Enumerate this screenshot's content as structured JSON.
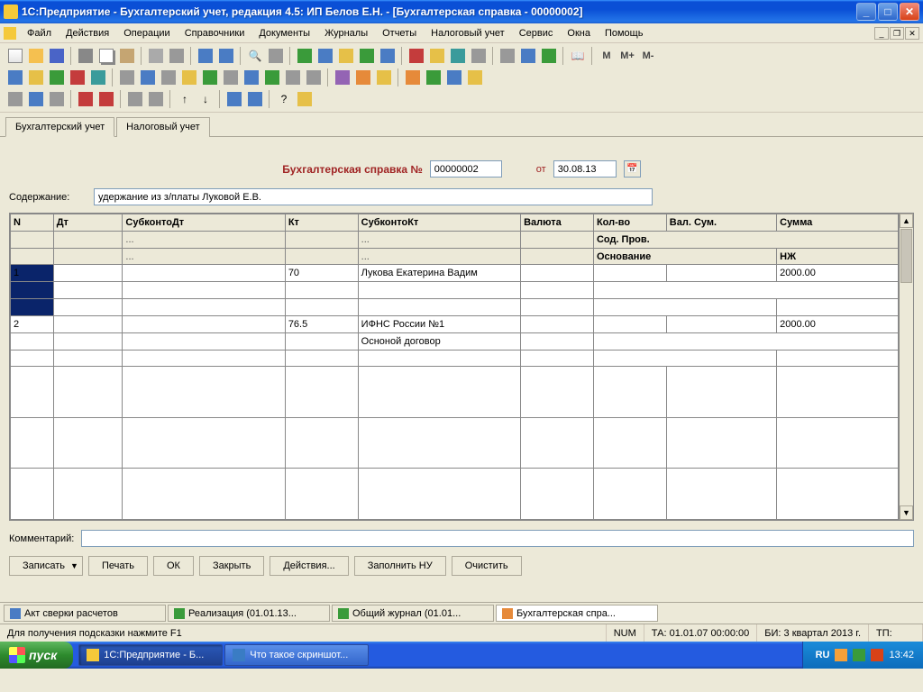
{
  "window": {
    "title": "1С:Предприятие - Бухгалтерский учет, редакция 4.5: ИП Белов Е.Н. - [Бухгалтерская справка - 00000002]"
  },
  "menu": {
    "file": "Файл",
    "actions": "Действия",
    "operations": "Операции",
    "refs": "Справочники",
    "docs": "Документы",
    "journals": "Журналы",
    "reports": "Отчеты",
    "tax": "Налоговый учет",
    "service": "Сервис",
    "windows": "Окна",
    "help": "Помощь"
  },
  "toolbar_text": {
    "m": "М",
    "mplus": "М+",
    "mminus": "М-"
  },
  "tabs": {
    "tab1": "Бухгалтерский учет",
    "tab2": "Налоговый учет"
  },
  "doc": {
    "heading": "Бухгалтерская справка №",
    "number": "00000002",
    "from_label": "от",
    "date": "30.08.13",
    "content_label": "Содержание:",
    "content_value": "удержание из з/платы Луковой Е.В."
  },
  "grid": {
    "cols": {
      "n": "N",
      "dt": "Дт",
      "subdt": "СубконтоДт",
      "kt": "Кт",
      "subkt": "СубконтоКт",
      "val": "Валюта",
      "qty": "Кол-во",
      "vsum": "Вал. Сум.",
      "sum": "Сумма",
      "sod": "Сод. Пров.",
      "osn": "Основание",
      "nzh": "НЖ",
      "dots": "..."
    },
    "rows": [
      {
        "n": "1",
        "dt": "",
        "subdt": "",
        "kt": "70",
        "subkt1": "Лукова Екатерина Вадим",
        "subkt2": "",
        "val": "",
        "qty": "",
        "vsum": "",
        "sum": "2000.00"
      },
      {
        "n": "2",
        "dt": "",
        "subdt": "",
        "kt": "76.5",
        "subkt1": "ИФНС России №1",
        "subkt2": "Осноной договор",
        "val": "",
        "qty": "",
        "vsum": "",
        "sum": "2000.00"
      }
    ]
  },
  "comment": {
    "label": "Комментарий:",
    "value": ""
  },
  "buttons": {
    "write": "Записать",
    "print": "Печать",
    "ok": "ОК",
    "close": "Закрыть",
    "actions": "Действия...",
    "fill_tax": "Заполнить НУ",
    "clear": "Очистить"
  },
  "wintabs": {
    "t1": "Акт сверки расчетов",
    "t2": "Реализация (01.01.13...",
    "t3": "Общий журнал (01.01...",
    "t4": "Бухгалтерская спра..."
  },
  "status": {
    "hint": "Для получения подсказки нажмите F1",
    "num": "NUM",
    "ta": "ТА: 01.01.07  00:00:00",
    "bi": "БИ: 3 квартал 2013 г.",
    "tp": "ТП:"
  },
  "taskbar": {
    "start": "пуск",
    "task1": "1С:Предприятие - Б...",
    "task2": "Что такое скриншот...",
    "lang": "RU",
    "clock": "13:42"
  }
}
